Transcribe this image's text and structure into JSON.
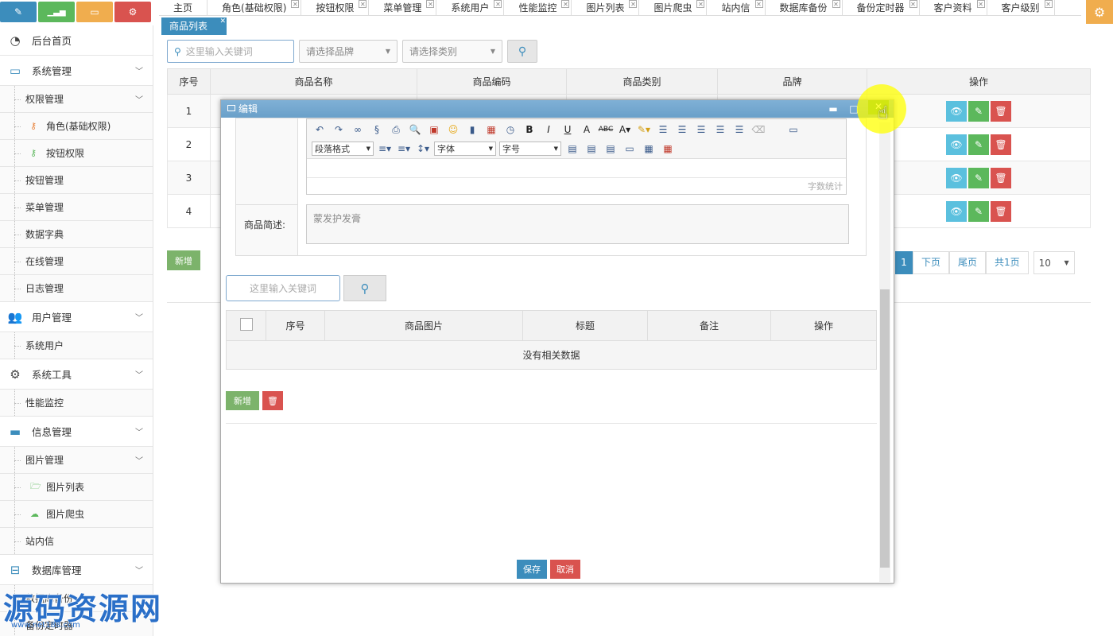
{
  "shortcuts": [
    {
      "icon": "pencil-icon",
      "glyph": "✎",
      "color": "#3c8dbc"
    },
    {
      "icon": "bar-chart-icon",
      "glyph": "▁▃▅",
      "color": "#5cb85c"
    },
    {
      "icon": "book-icon",
      "glyph": "▭",
      "color": "#f0ad4e"
    },
    {
      "icon": "cogs-icon",
      "glyph": "⚙",
      "color": "#d9534f"
    }
  ],
  "sidebar": {
    "home": "后台首页",
    "sys_mgmt": "系统管理",
    "perm_mgmt": "权限管理",
    "role": "角色(基础权限)",
    "btn_perm": "按钮权限",
    "btn_mgmt": "按钮管理",
    "menu_mgmt": "菜单管理",
    "dict": "数据字典",
    "online": "在线管理",
    "log": "日志管理",
    "user_mgmt": "用户管理",
    "sys_user": "系统用户",
    "sys_tools": "系统工具",
    "perf": "性能监控",
    "info_mgmt": "信息管理",
    "img_mgmt": "图片管理",
    "img_list": "图片列表",
    "img_crawler": "图片爬虫",
    "inbox": "站内信",
    "db_mgmt": "数据库管理",
    "db_backup": "数据库备份",
    "backup_timer": "备份定时器"
  },
  "tabs": [
    "主页",
    "角色(基础权限)",
    "按钮权限",
    "菜单管理",
    "系统用户",
    "性能监控",
    "图片列表",
    "图片爬虫",
    "站内信",
    "数据库备份",
    "备份定时器",
    "客户资料",
    "客户级别"
  ],
  "subtab": "商品列表",
  "search": {
    "placeholder": "这里输入关键词",
    "brand": "请选择品牌",
    "category": "请选择类别"
  },
  "table": {
    "headers": [
      "序号",
      "商品名称",
      "商品编码",
      "商品类别",
      "品牌",
      "操作"
    ],
    "rows": [
      "1",
      "2",
      "3",
      "4"
    ]
  },
  "add_label": "新增",
  "pager": {
    "current": "1",
    "next": "下页",
    "last": "尾页",
    "total": "共1页",
    "size": "10"
  },
  "modal": {
    "title": "编辑",
    "para_format": "段落格式",
    "font": "字体",
    "font_size": "字号",
    "word_count": "字数统计",
    "desc_label": "商品简述:",
    "desc_value": "蒙发护发膏",
    "search_placeholder": "这里输入关键词",
    "sub_headers": [
      "序号",
      "商品图片",
      "标题",
      "备注",
      "操作"
    ],
    "no_data": "没有相关数据",
    "add": "新增",
    "save": "保存",
    "cancel": "取消"
  },
  "watermark": {
    "text": "源码资源网",
    "url": "www.net188.com"
  }
}
